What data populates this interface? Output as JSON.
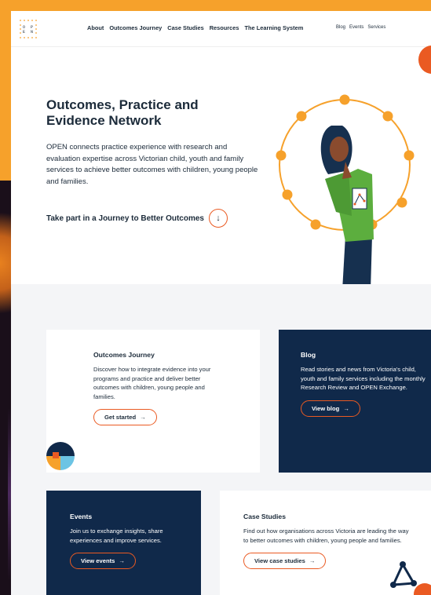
{
  "brand": {
    "logo_text_1": "O P",
    "logo_text_2": "E N"
  },
  "nav": {
    "main": [
      "About",
      "Outcomes Journey",
      "Case Studies",
      "Resources",
      "The Learning System"
    ],
    "sub": [
      "Blog",
      "Events",
      "Services"
    ]
  },
  "hero": {
    "title": "Outcomes, Practice and Evidence Network",
    "description": "OPEN connects practice experience with research and evaluation expertise across Victorian child, youth and family services to achieve better outcomes with children, young people and families.",
    "cta_label": "Take part in a Journey to Better Outcomes",
    "cta_icon": "↓"
  },
  "cards": {
    "journey": {
      "title": "Outcomes Journey",
      "text": "Discover how to integrate evidence into your programs and practice and deliver better outcomes with children, young people and families.",
      "button": "Get started",
      "arrow": "→"
    },
    "blog": {
      "title": "Blog",
      "text": "Read stories and news from Victoria's child, youth and family services including the monthly Research Review and OPEN Exchange.",
      "button": "View blog",
      "arrow": "→"
    },
    "events": {
      "title": "Events",
      "text": "Join us to exchange insights, share experiences and improve services.",
      "button": "View events",
      "arrow": "→"
    },
    "case_studies": {
      "title": "Case Studies",
      "text": "Find out how organisations across Victoria are leading the way to better outcomes with children, young people and families.",
      "button": "View case studies",
      "arrow": "→"
    }
  },
  "colors": {
    "orange": "#f6a12b",
    "accent": "#ea5a22",
    "navy": "#10294a",
    "text": "#1c2b3a"
  }
}
